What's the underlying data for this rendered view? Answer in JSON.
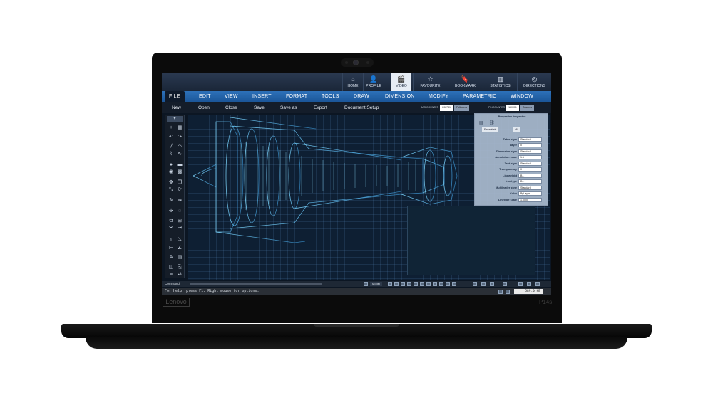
{
  "device": {
    "brand": "Lenovo",
    "model": "P14s"
  },
  "icon_tabs": [
    {
      "label": "HOME",
      "icon": "home-icon",
      "glyph": "⌂"
    },
    {
      "label": "PROFILE",
      "icon": "user-icon",
      "glyph": "👤"
    },
    {
      "label": "VIDEO",
      "icon": "video-icon",
      "glyph": "🎬",
      "active": true
    },
    {
      "label": "FAVOURITE",
      "icon": "star-icon",
      "glyph": "☆"
    },
    {
      "label": "BOOKMARK",
      "icon": "bookmark-icon",
      "glyph": "🔖"
    },
    {
      "label": "STATISTICS",
      "icon": "bar-chart-icon",
      "glyph": "▥"
    },
    {
      "label": "DIRECTIONS",
      "icon": "compass-icon",
      "glyph": "◎"
    }
  ],
  "menu": [
    "FILE",
    "EDIT",
    "VIEW",
    "INSERT",
    "FORMAT",
    "TOOLS",
    "DRAW",
    "DIMENSION",
    "MODIFY",
    "PARAMETRIC",
    "WINDOW"
  ],
  "submenu": [
    "New",
    "Open",
    "Close",
    "Save",
    "Save as",
    "Export",
    "Document Setup"
  ],
  "counters": {
    "left_label": "BASICOUNTER",
    "left_value": "206781",
    "left_tag": "Followers",
    "right_label": "PINCOUNTER",
    "right_value": "120001",
    "right_tag": "Readers"
  },
  "properties": {
    "title": "Properties Inspector",
    "tabs": [
      "Essentials",
      "All"
    ],
    "rows": [
      {
        "label": "Table style",
        "value": "Standard"
      },
      {
        "label": "Layer",
        "value": "0"
      },
      {
        "label": "Dimension style",
        "value": "Standard"
      },
      {
        "label": "Annotation scale",
        "value": "1:1"
      },
      {
        "label": "Text style",
        "value": "Standard"
      },
      {
        "label": "Transparency",
        "value": "0"
      },
      {
        "label": "Lineweight",
        "value": "B..."
      },
      {
        "label": "Linetype",
        "value": "B..."
      },
      {
        "label": "Multileader style",
        "value": "Standard"
      },
      {
        "label": "Color",
        "value": "ByLayer"
      },
      {
        "label": "Linetype scale",
        "value": "1.0000"
      }
    ]
  },
  "command": {
    "label": "Command",
    "model": "Model"
  },
  "status": {
    "hint": "For Help, press F1. Right mouse for options.",
    "value": "589.0 HB"
  },
  "colors": {
    "accent": "#2d71b9",
    "blueprint": "#5fc8ff",
    "canvas": "#0e1f33"
  }
}
